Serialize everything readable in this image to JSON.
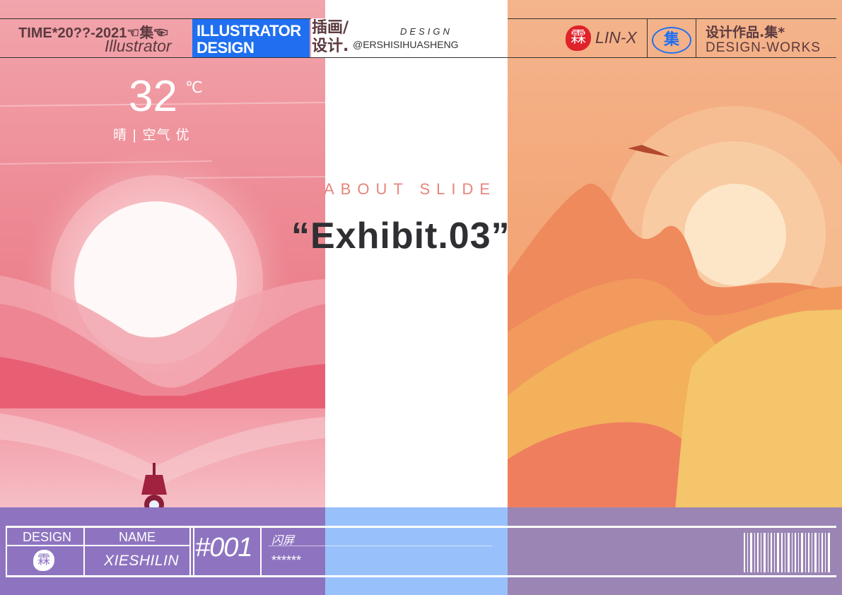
{
  "header": {
    "time_label": "TIME*20??-2021☜集☜",
    "illustrator_script": "Illustrator",
    "badge_line1": "ILLUSTRATOR",
    "badge_line2": "DESIGN",
    "cn_line1": "插画/",
    "cn_line2": "设计.",
    "design_small": "DESIGN",
    "handle": "@ERSHISIHUASHENG",
    "seal_char": "霖",
    "brand": "LIN-X",
    "ji_char": "集",
    "works_cn": "设计作品.集*",
    "works_en": "DESIGN-WORKS"
  },
  "weather": {
    "temp": "32",
    "unit": "℃",
    "status": "晴 | 空气 优"
  },
  "center": {
    "subtitle": "ABOUT SLIDE",
    "title": "“Exhibit.03”"
  },
  "footer": {
    "design_label": "DESIGN",
    "seal_char": "霖",
    "name_label": "NAME",
    "name_value": "XIESHILIN",
    "number": "#001",
    "cn_title": "闪屏",
    "stars": "******"
  },
  "colors": {
    "pink": "#ee8e98",
    "orange": "#f39a62",
    "accent_blue": "#1f6ff0",
    "seal_red": "#e0222a"
  }
}
